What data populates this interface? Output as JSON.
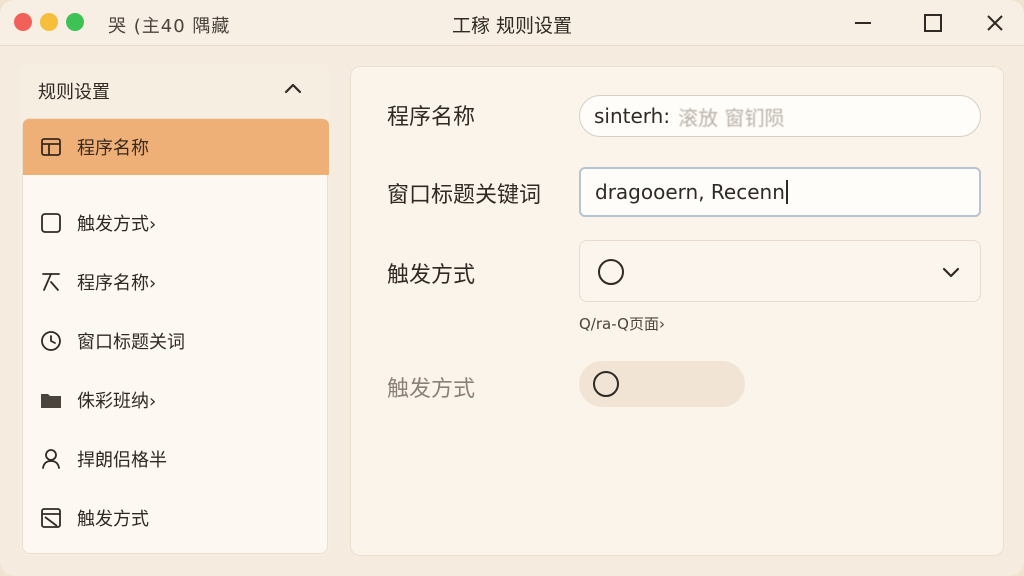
{
  "titlebar": {
    "app_label": "哭 (主40 隅藏",
    "title": "工稼 规则设置"
  },
  "sidebar": {
    "header": "规则设置",
    "items": [
      {
        "label": "程序名称",
        "icon": "layout-icon",
        "active": true
      },
      {
        "label": "触发方式›",
        "icon": "square-icon",
        "active": false
      },
      {
        "label": "程序名称›",
        "icon": "branch-icon",
        "active": false
      },
      {
        "label": "窗口标题关词",
        "icon": "clock-icon",
        "active": false
      },
      {
        "label": "侏彩班纳›",
        "icon": "folder-icon",
        "active": false
      },
      {
        "label": "捍朗侣格半",
        "icon": "user-icon",
        "active": false
      },
      {
        "label": "触发方式",
        "icon": "window-icon",
        "active": false
      }
    ]
  },
  "form": {
    "program_name": {
      "label": "程序名称",
      "value": "sinterh:",
      "value_blurred": "滚放 窗钔陨"
    },
    "window_keyword": {
      "label": "窗口标题关键词",
      "value": "dragooern, Recenn"
    },
    "trigger": {
      "label": "触发方式",
      "hint": "Q/ra-Q页面›"
    },
    "trigger_disabled": {
      "label": "触发方式"
    }
  },
  "colors": {
    "accent": "#eeb077",
    "background": "#f5ecdf",
    "text": "#2f2a25"
  }
}
